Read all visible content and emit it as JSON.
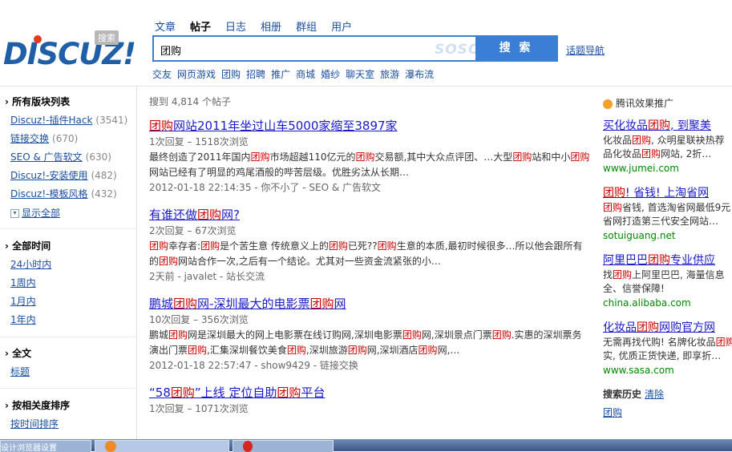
{
  "logo": {
    "text": "DISCUZ!",
    "badge": "搜索"
  },
  "tabs": [
    {
      "label": "文章",
      "active": false
    },
    {
      "label": "帖子",
      "active": true
    },
    {
      "label": "日志",
      "active": false
    },
    {
      "label": "相册",
      "active": false
    },
    {
      "label": "群组",
      "active": false
    },
    {
      "label": "用户",
      "active": false
    }
  ],
  "search": {
    "value": "团购",
    "watermark": "SOSO",
    "button": "搜 索"
  },
  "topic_nav": "话题导航",
  "quick_links": [
    "交友",
    "网页游戏",
    "团购",
    "招聘",
    "推广",
    "商城",
    "婚纱",
    "聊天室",
    "旅游",
    "瀑布流"
  ],
  "sidebar": {
    "forums_title": "所有版块列表",
    "forums": [
      {
        "name": "Discuz!-插件Hack",
        "count": "(3541)"
      },
      {
        "name": "链接交换",
        "count": "(670)"
      },
      {
        "name": "SEO & 广告软文",
        "count": "(630)"
      },
      {
        "name": "Discuz!-安装使用",
        "count": "(482)"
      },
      {
        "name": "Discuz!-模板风格",
        "count": "(432)"
      }
    ],
    "show_all": "显示全部",
    "time_title": "全部时间",
    "times": [
      "24小时内",
      "1周内",
      "1月内",
      "1年内"
    ],
    "fulltext_title": "全文",
    "fulltext_item": "标题",
    "sort_title": "按相关度排序",
    "sort_item": "按时间排序"
  },
  "results": {
    "count": "搜到 4,814 个帖子",
    "items": [
      {
        "title": [
          [
            "团购",
            true
          ],
          [
            "网站2011年坐过山车5000家缩至3897家",
            false
          ]
        ],
        "meta": "1次回复 – 1518次浏览",
        "snippet": [
          [
            "最终创造了2011年国内",
            false
          ],
          [
            "团购",
            true
          ],
          [
            "市场超越110亿元的",
            false
          ],
          [
            "团购",
            true
          ],
          [
            "交易额,其中大众点评团、…大型",
            false
          ],
          [
            "团购",
            true
          ],
          [
            "站和中小",
            false
          ],
          [
            "团购",
            true
          ],
          [
            "网站已经有了明显的鸡尾酒般的哔苦层级。优胜劣汰从长期…",
            false
          ]
        ],
        "foot": "2012-01-18 22:14:35 - 你不小了 - SEO & 广告软文"
      },
      {
        "title": [
          [
            "有谁还做",
            false
          ],
          [
            "团购",
            true
          ],
          [
            "网?",
            false
          ]
        ],
        "meta": "2次回复 – 67次浏览",
        "snippet": [
          [
            "团购",
            true
          ],
          [
            "幸存者:",
            false
          ],
          [
            "团购",
            true
          ],
          [
            "是个苦生意 传统意义上的",
            false
          ],
          [
            "团购",
            true
          ],
          [
            "已死??",
            false
          ],
          [
            "团购",
            true
          ],
          [
            "生意的本质,最初时候很多…所以他会跟所有的",
            false
          ],
          [
            "团购",
            true
          ],
          [
            "网站合作一次,之后有一个结论。尤其对一些资金流紧张的小…",
            false
          ]
        ],
        "foot": "2天前 - javalet - 站长交流"
      },
      {
        "title": [
          [
            "鹏城",
            false
          ],
          [
            "团购",
            true
          ],
          [
            "网-深圳最大的电影票",
            false
          ],
          [
            "团购",
            true
          ],
          [
            "网",
            false
          ]
        ],
        "meta": "10次回复 – 356次浏览",
        "snippet": [
          [
            "鹏城",
            false
          ],
          [
            "团购",
            true
          ],
          [
            "网是深圳最大的网上电影票在线订购网,深圳电影票",
            false
          ],
          [
            "团购",
            true
          ],
          [
            "网,深圳景点门票",
            false
          ],
          [
            "团购",
            true
          ],
          [
            ".实惠的深圳票务演出门票",
            false
          ],
          [
            "团购",
            true
          ],
          [
            ",汇集深圳餐饮美食",
            false
          ],
          [
            "团购",
            true
          ],
          [
            ",深圳旅游",
            false
          ],
          [
            "团购",
            true
          ],
          [
            "网,深圳酒店",
            false
          ],
          [
            "团购",
            true
          ],
          [
            "网,…",
            false
          ]
        ],
        "foot": "2012-01-18 22:57:47 - show9429 - 链接交换"
      },
      {
        "title": [
          [
            "“58",
            false
          ],
          [
            "团购",
            true
          ],
          [
            "”上线 定位自助",
            false
          ],
          [
            "团购",
            true
          ],
          [
            "平台",
            false
          ]
        ],
        "meta": "1次回复 – 1071次浏览",
        "snippet": [],
        "foot": ""
      }
    ]
  },
  "ads": {
    "header": "腾讯效果推广",
    "items": [
      {
        "title": [
          [
            "买化妆品",
            false
          ],
          [
            "团购",
            true
          ],
          [
            ", 到聚美",
            false
          ]
        ],
        "desc": [
          [
            "化妆品",
            false
          ],
          [
            "团购",
            true
          ],
          [
            ", 众明星联袂热荐",
            false
          ]
        ],
        "desc2": [
          [
            "品化妆品",
            false
          ],
          [
            "团购",
            true
          ],
          [
            "网站, 2折…",
            false
          ]
        ],
        "url": "www.jumei.com"
      },
      {
        "title": [
          [
            "团购",
            true
          ],
          [
            "! 省钱! 上淘省网",
            false
          ]
        ],
        "desc": [
          [
            "团购",
            true
          ],
          [
            "省钱, 首选淘省网最低9元",
            false
          ]
        ],
        "desc2": [
          [
            "省网打造第三代安全网站…",
            false
          ]
        ],
        "url": "sotuiguang.net"
      },
      {
        "title": [
          [
            "阿里巴巴",
            false
          ],
          [
            "团购",
            true
          ],
          [
            "专业供应",
            false
          ]
        ],
        "desc": [
          [
            "找",
            false
          ],
          [
            "团购",
            true
          ],
          [
            "上阿里巴巴, 海量信息",
            false
          ]
        ],
        "desc2": [
          [
            "全、信誉保障!",
            false
          ]
        ],
        "url": "china.alibaba.com"
      },
      {
        "title": [
          [
            "化妆品",
            false
          ],
          [
            "团购",
            true
          ],
          [
            "网购官方网",
            false
          ]
        ],
        "desc": [
          [
            "无需再找代购! 名牌化妆品",
            false
          ],
          [
            "团购",
            true
          ]
        ],
        "desc2": [
          [
            "实, 优质正货快递, 即享折…",
            false
          ]
        ],
        "url": "www.sasa.com"
      }
    ],
    "history_title": "搜索历史",
    "history_clear": "清除",
    "history_items": [
      "团购"
    ]
  },
  "taskbar": {
    "items": [
      "设计浏览器设置",
      "",
      ""
    ]
  }
}
